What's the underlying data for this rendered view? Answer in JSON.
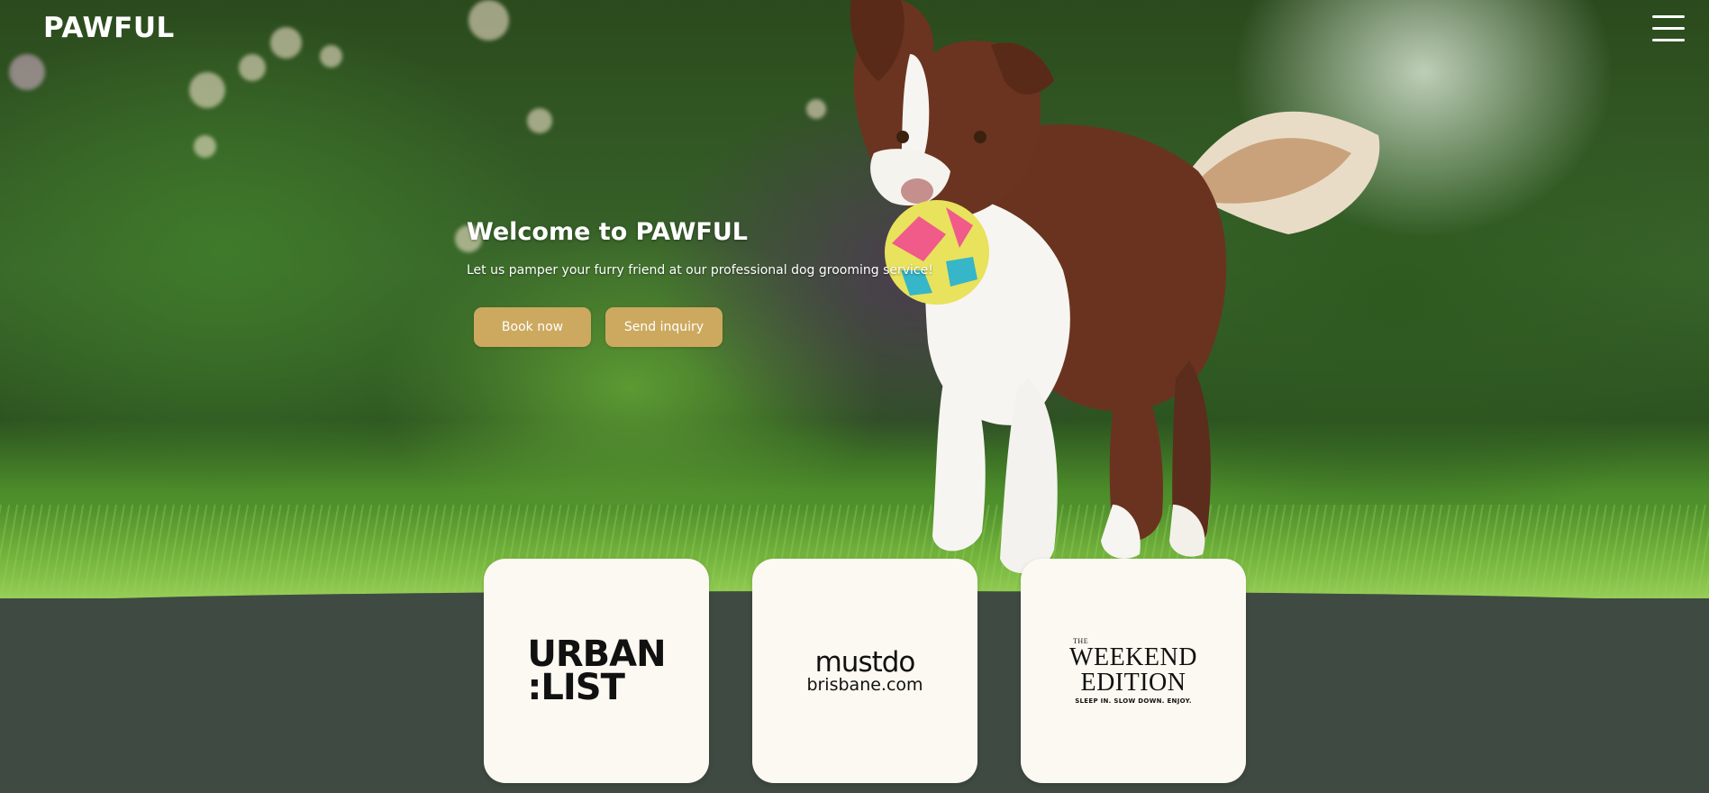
{
  "header": {
    "brand": "PAWFUL",
    "menu_icon": "hamburger-menu-icon"
  },
  "hero": {
    "title": "Welcome to PAWFUL",
    "subtitle": "Let us pamper your furry friend at our professional dog grooming service!",
    "buttons": {
      "book_label": "Book now",
      "inquiry_label": "Send inquiry"
    },
    "image": "border-collie-with-ball-on-grass"
  },
  "press": {
    "logos": [
      {
        "name": "urban-list-logo",
        "line1": "URBAN",
        "line2": ":LIST"
      },
      {
        "name": "mustdo-brisbane-logo",
        "line1": "mustdo",
        "line2": "brisbane.com"
      },
      {
        "name": "weekend-edition-logo",
        "kicker": "THE",
        "line1": "WEEKEND",
        "line2": "EDITION",
        "tagline": "SLEEP IN. SLOW DOWN. ENJOY."
      }
    ]
  },
  "colors": {
    "button": "#cda95f",
    "band": "#3f4a42",
    "card": "#fbf9f1"
  }
}
